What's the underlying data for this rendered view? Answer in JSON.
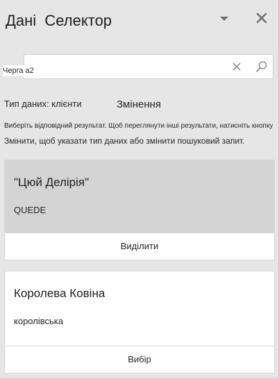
{
  "header": {
    "title": "Дані  Селектор"
  },
  "search": {
    "value": "Черга а2"
  },
  "filter": {
    "data_type": "Тип даних: клієнти",
    "change_label": "Змінення"
  },
  "hint": {
    "line1": "Виберіть відповідний результат. Щоб переглянути інші результати, натисніть кнопку",
    "line2": "Змінити, щоб указати тип даних або змінити пошуковий запит."
  },
  "results": [
    {
      "name": "\"Цюй Делірія\"",
      "subtitle": "QUEDE",
      "button": "Виділити",
      "selected": true
    },
    {
      "name": "Королева Ковіна",
      "subtitle": "королівська",
      "button": "Вибір",
      "selected": false
    }
  ],
  "colors": {
    "pane_background": "#e6e6e6",
    "selected_card": "#d4d4d4",
    "card": "#ffffff",
    "text": "#262626"
  },
  "icons": {
    "dropdown": "chevron-down-icon",
    "close": "close-icon",
    "clear": "clear-icon",
    "search": "search-icon"
  }
}
